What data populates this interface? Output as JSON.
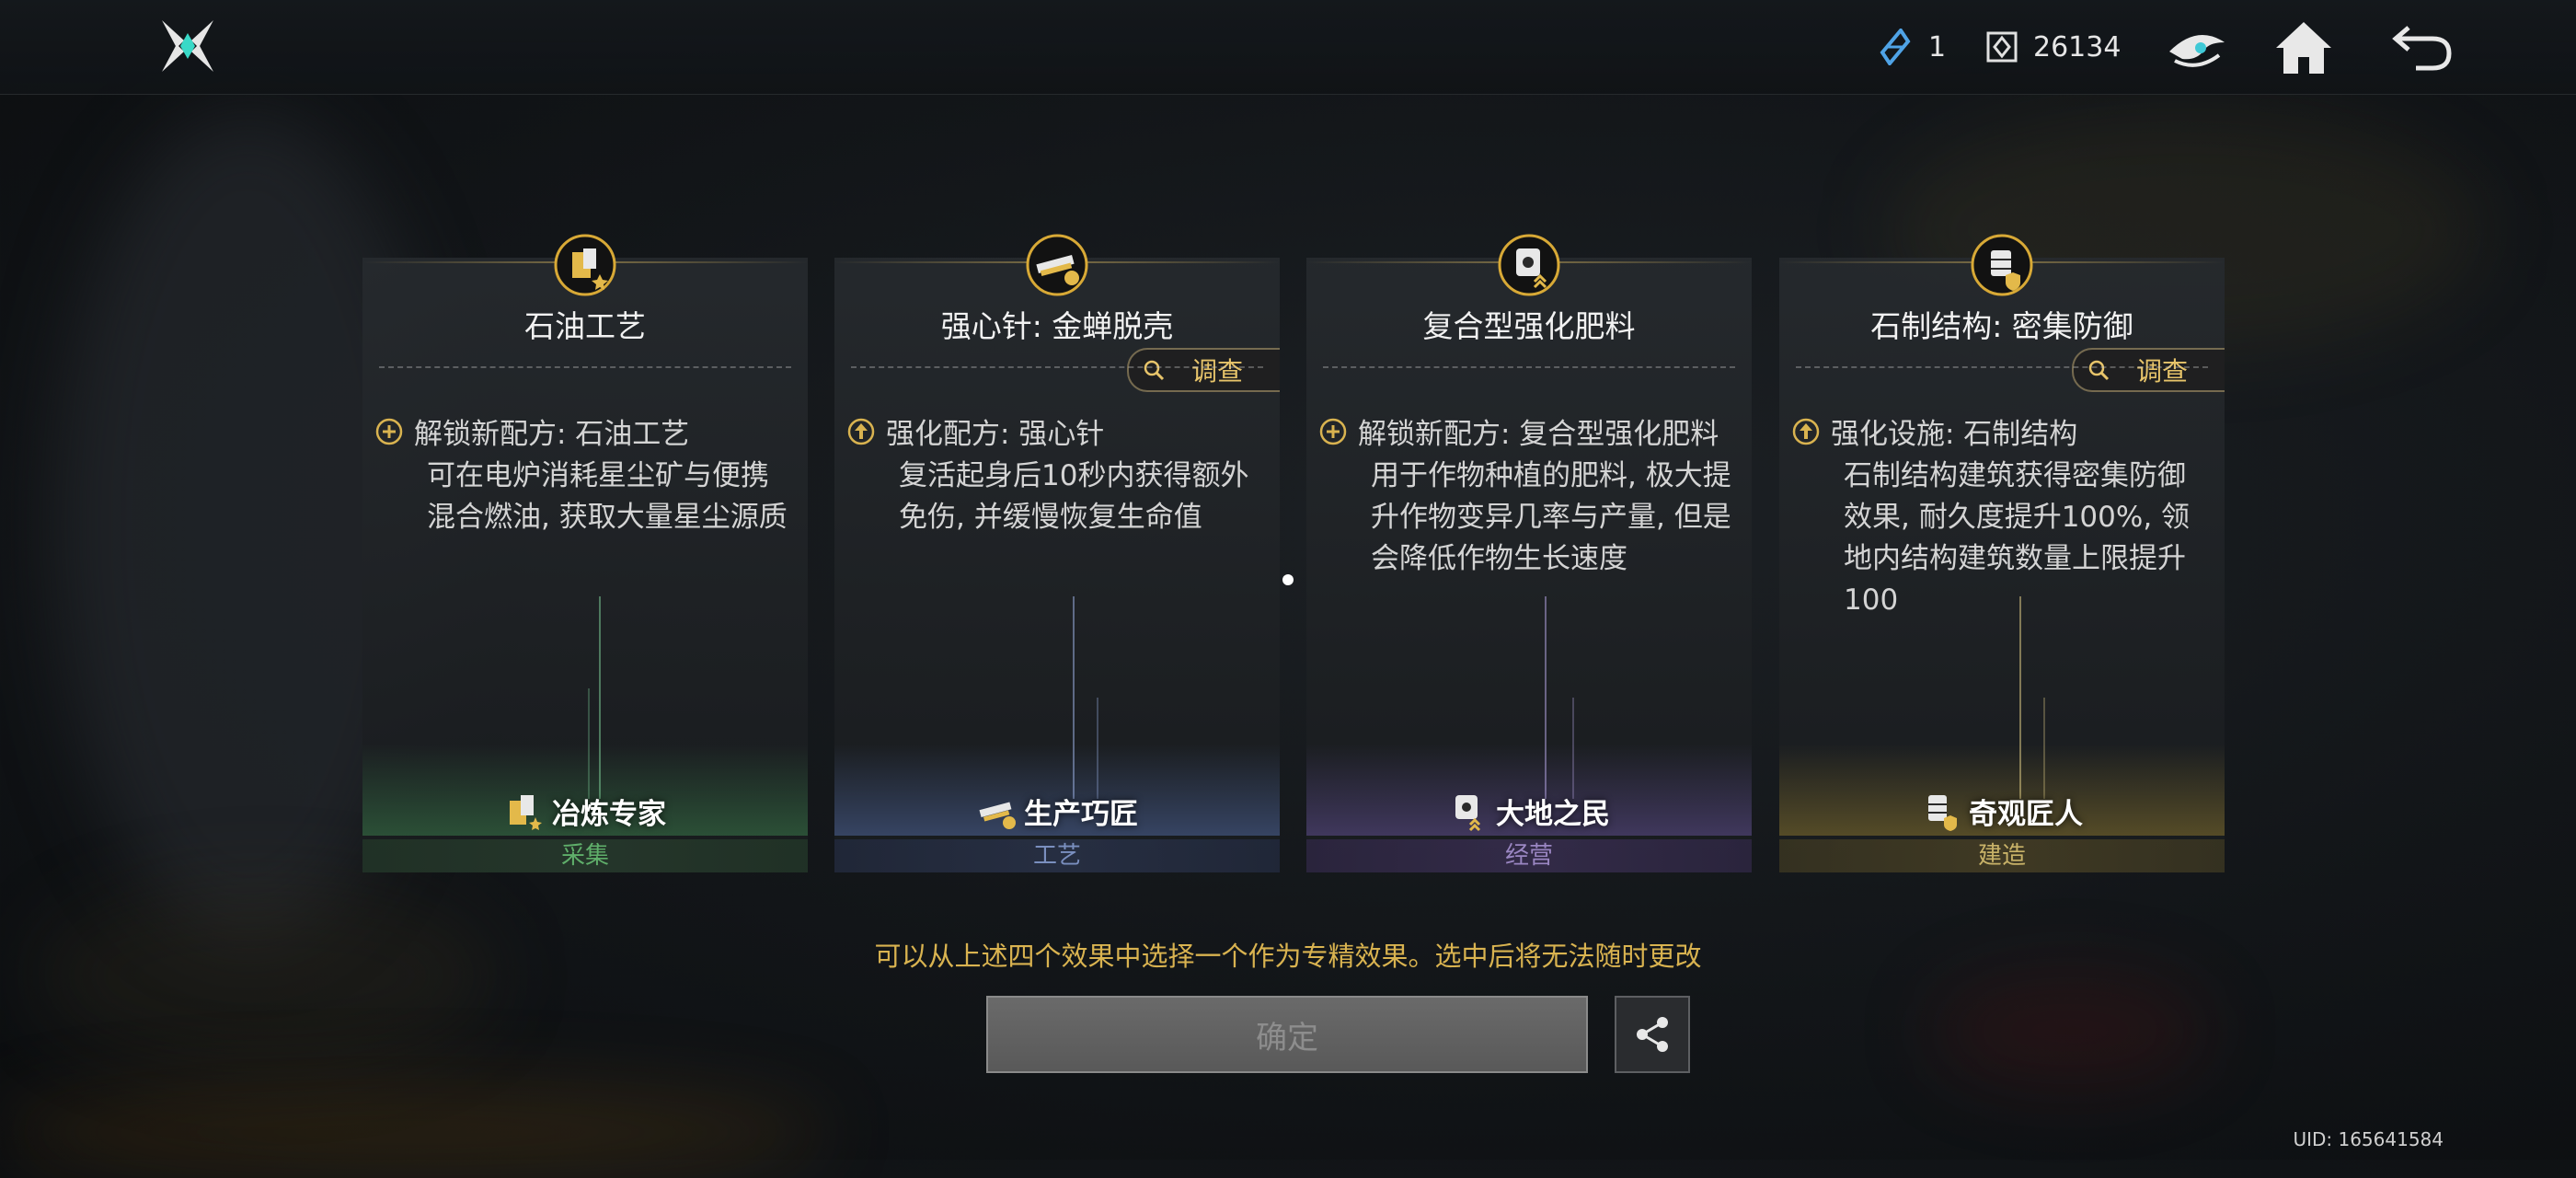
{
  "topbar": {
    "resource_1": {
      "icon": "star-crystal-icon",
      "value": "1"
    },
    "resource_2": {
      "icon": "token-icon",
      "value": "26134"
    },
    "buttons": [
      "eye-emblem-icon",
      "home-icon",
      "back-icon"
    ]
  },
  "cards": [
    {
      "title": "石油工艺",
      "investigate": null,
      "effect_head": "解锁新配方: 石油工艺",
      "effect_desc": "可在电炉消耗星尘矿与便携混合燃油, 获取大量星尘源质",
      "role_name": "冶炼专家",
      "category": "采集",
      "category_color": "#5fae6a",
      "bullet": "plus-circle-icon"
    },
    {
      "title": "强心针: 金蝉脱壳",
      "investigate": "调查",
      "effect_head": "强化配方: 强心针",
      "effect_desc": "复活起身后10秒内获得额外免伤, 并缓慢恢复生命值",
      "role_name": "生产巧匠",
      "category": "工艺",
      "category_color": "#7a8fbf",
      "bullet": "arrow-up-circle-icon"
    },
    {
      "title": "复合型强化肥料",
      "investigate": null,
      "effect_head": "解锁新配方: 复合型强化肥料",
      "effect_desc": "用于作物种植的肥料, 极大提升作物变异几率与产量, 但是会降低作物生长速度",
      "role_name": "大地之民",
      "category": "经营",
      "category_color": "#9a86c2",
      "bullet": "plus-circle-icon"
    },
    {
      "title": "石制结构: 密集防御",
      "investigate": "调查",
      "effect_head": "强化设施: 石制结构",
      "effect_desc": "石制结构建筑获得密集防御效果, 耐久度提升100%, 领地内结构建筑数量上限提升100",
      "role_name": "奇观匠人",
      "category": "建造",
      "category_color": "#c8b268",
      "bullet": "arrow-up-circle-icon"
    }
  ],
  "hint": "可以从上述四个效果中选择一个作为专精效果。选中后将无法随时更改",
  "confirm_label": "确定",
  "uid": "UID: 165641584"
}
